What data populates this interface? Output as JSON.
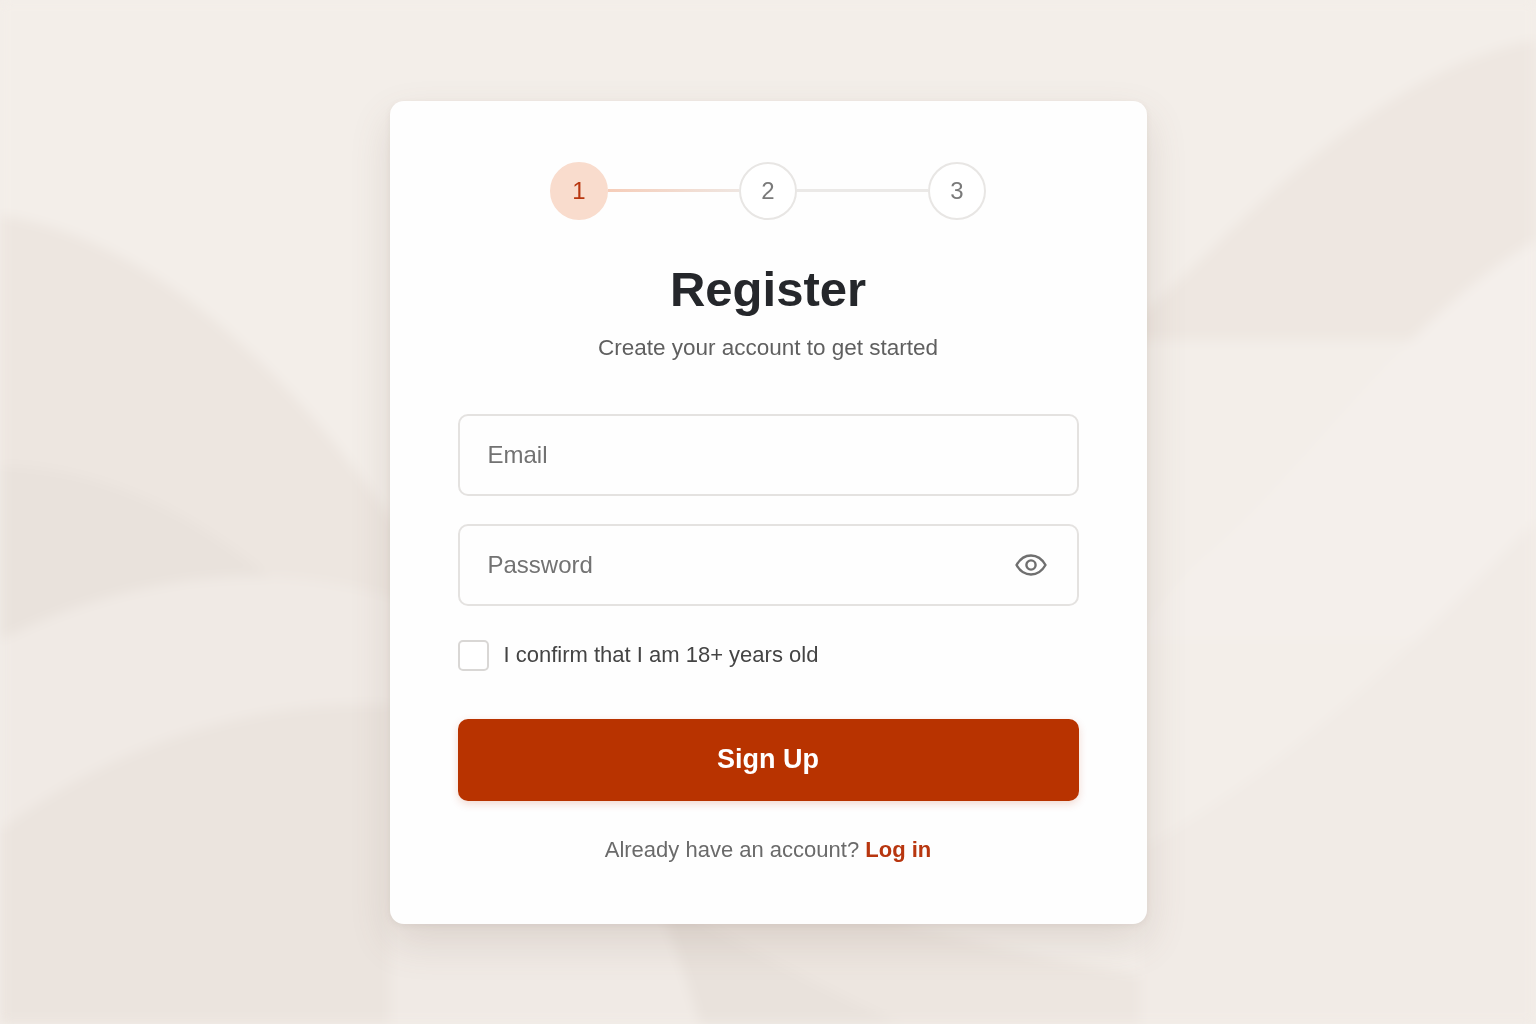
{
  "stepper": {
    "steps": [
      {
        "label": "1",
        "selected": true
      },
      {
        "label": "2",
        "selected": false
      },
      {
        "label": "3",
        "selected": false
      }
    ]
  },
  "title": "Register",
  "subtitle": "Create your account to get started",
  "fields": [
    {
      "kind": "email",
      "placeholder": "Email"
    },
    {
      "kind": "password",
      "placeholder": "Password"
    }
  ],
  "age_confirm": {
    "label": "I confirm that I am 18+ years old",
    "checked": false
  },
  "submit_button": {
    "label": "Sign Up"
  },
  "footer": {
    "text": "Already have an account?",
    "link": "Log in"
  }
}
